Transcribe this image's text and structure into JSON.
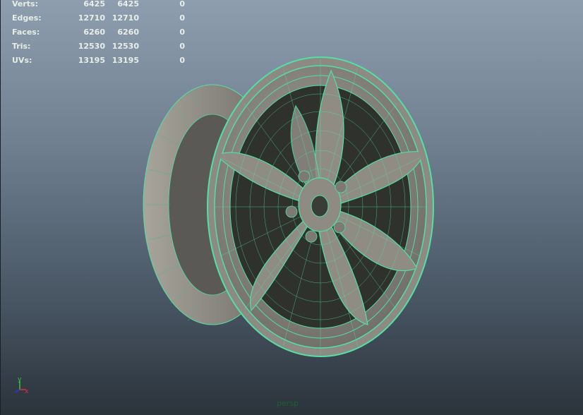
{
  "hud": {
    "rows": [
      {
        "label": "Verts:",
        "values": [
          "6425",
          "6425",
          "0"
        ]
      },
      {
        "label": "Edges:",
        "values": [
          "12710",
          "12710",
          "0"
        ]
      },
      {
        "label": "Faces:",
        "values": [
          "6260",
          "6260",
          "0"
        ]
      },
      {
        "label": "Tris:",
        "values": [
          "12530",
          "12530",
          "0"
        ]
      },
      {
        "label": "UVs:",
        "values": [
          "13195",
          "13195",
          "0"
        ]
      }
    ]
  },
  "axis": {
    "y": "y",
    "x": "x"
  },
  "camera_name": "persp",
  "colors": {
    "wire": "#52e0a4",
    "shade": "#8a877f",
    "dark": "#2e302c",
    "axis_x": "#d33",
    "axis_y": "#3c3",
    "axis_z": "#33d"
  }
}
